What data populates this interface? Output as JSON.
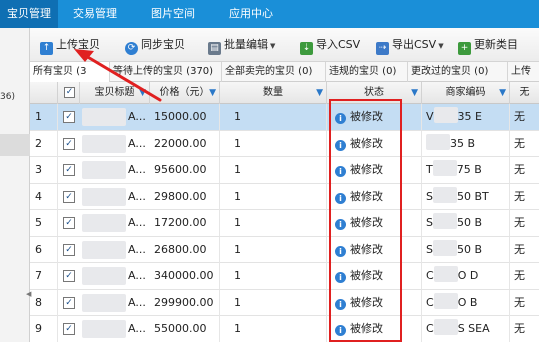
{
  "topnav": {
    "tabs": [
      {
        "label": "宝贝管理",
        "active": true
      },
      {
        "label": "交易管理",
        "active": false
      },
      {
        "label": "图片空间",
        "active": false
      },
      {
        "label": "应用中心",
        "active": false
      }
    ]
  },
  "sidebar": {
    "count": "36)"
  },
  "toolbar": {
    "upload": "上传宝贝",
    "sync": "同步宝贝",
    "batch_edit": "批量编辑",
    "import_csv": "导入CSV",
    "export_csv": "导出CSV",
    "update_category": "更新类目"
  },
  "filter_tabs": [
    "所有宝贝 (3",
    "等待上传的宝贝 (370)",
    "全部卖完的宝贝 (0)",
    "违规的宝贝 (0)",
    "更改过的宝贝 (0)",
    "上传"
  ],
  "table": {
    "headers": {
      "title": "宝贝标题",
      "price": "价格（元）",
      "quantity": "数量",
      "status": "状态",
      "merchant_code": "商家编码",
      "last": "无"
    },
    "rows": [
      {
        "num": "1",
        "checked": "✓",
        "title": "A...",
        "price": "15000.00",
        "qty": "1",
        "status": "被修改",
        "code_l": "V",
        "code_r": "35 E",
        "last": "无"
      },
      {
        "num": "2",
        "checked": "✓",
        "title": "A...",
        "price": "22000.00",
        "qty": "1",
        "status": "被修改",
        "code_l": "",
        "code_r": "35 B",
        "last": "无"
      },
      {
        "num": "3",
        "checked": "✓",
        "title": "A...",
        "price": "95600.00",
        "qty": "1",
        "status": "被修改",
        "code_l": "T",
        "code_r": "75 B",
        "last": "无"
      },
      {
        "num": "4",
        "checked": "✓",
        "title": "A...",
        "price": "29800.00",
        "qty": "1",
        "status": "被修改",
        "code_l": "S",
        "code_r": "50 BT",
        "last": "无"
      },
      {
        "num": "5",
        "checked": "✓",
        "title": "A...",
        "price": "17200.00",
        "qty": "1",
        "status": "被修改",
        "code_l": "S",
        "code_r": "50 B",
        "last": "无"
      },
      {
        "num": "6",
        "checked": "✓",
        "title": "A...",
        "price": "26800.00",
        "qty": "1",
        "status": "被修改",
        "code_l": "S",
        "code_r": "50 B",
        "last": "无"
      },
      {
        "num": "7",
        "checked": "✓",
        "title": "A...",
        "price": "340000.00",
        "qty": "1",
        "status": "被修改",
        "code_l": "C",
        "code_r": "O D",
        "last": "无"
      },
      {
        "num": "8",
        "checked": "✓",
        "title": "A...",
        "price": "299900.00",
        "qty": "1",
        "status": "被修改",
        "code_l": "C",
        "code_r": "O B",
        "last": "无"
      },
      {
        "num": "9",
        "checked": "✓",
        "title": "A...",
        "price": "55000.00",
        "qty": "1",
        "status": "被修改",
        "code_l": "C",
        "code_r": "S SEA",
        "last": "无"
      }
    ]
  },
  "colors": {
    "nav_blue": "#1a8fd8",
    "selected_row": "#c4ddf3",
    "annotation_red": "#e02020",
    "info_blue": "#2f7fd2"
  }
}
